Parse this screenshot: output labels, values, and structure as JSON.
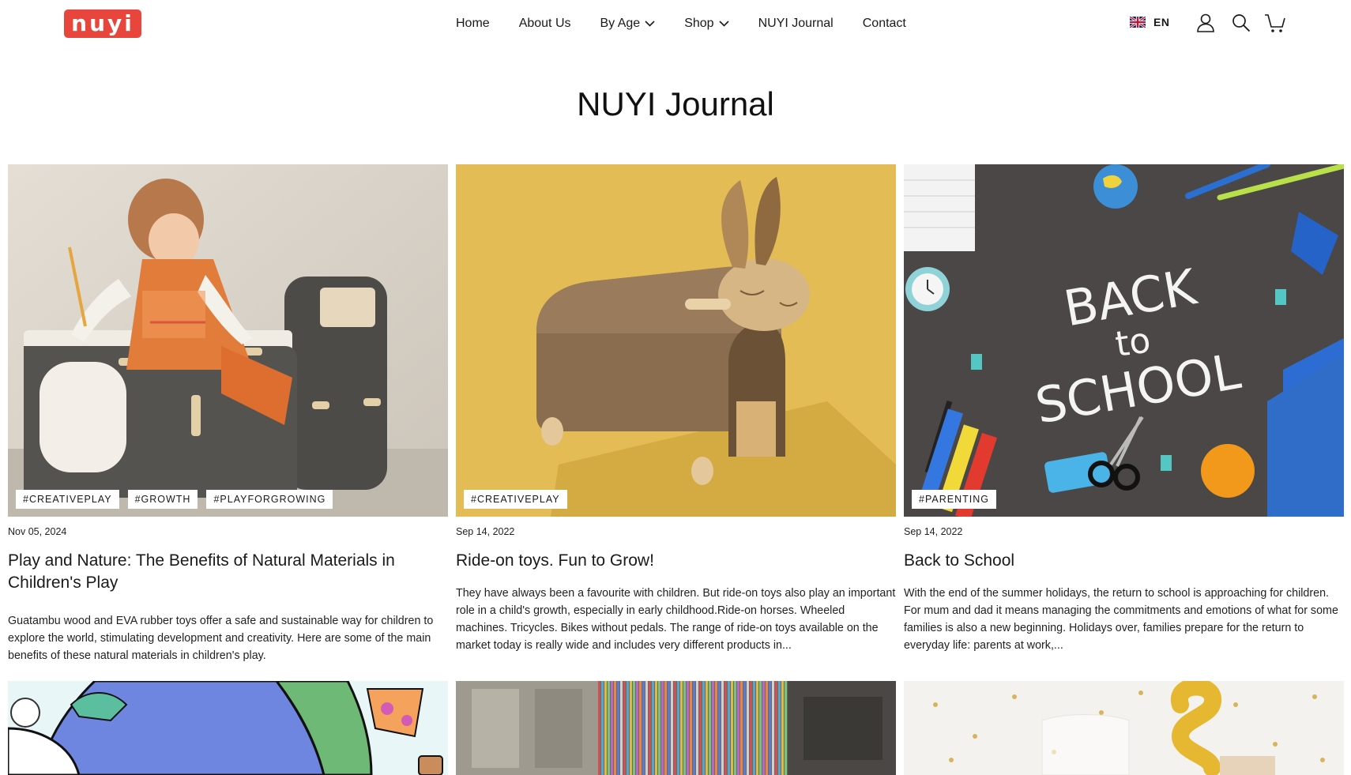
{
  "header": {
    "logo_text": "nuyi",
    "nav": [
      {
        "label": "Home",
        "dropdown": false
      },
      {
        "label": "About Us",
        "dropdown": false
      },
      {
        "label": "By Age",
        "dropdown": true
      },
      {
        "label": "Shop",
        "dropdown": true
      },
      {
        "label": "NUYI Journal",
        "dropdown": false
      },
      {
        "label": "Contact",
        "dropdown": false
      }
    ],
    "language": "EN",
    "icons": [
      "account-icon",
      "search-icon",
      "cart-icon"
    ]
  },
  "page_title": "NUYI Journal",
  "articles": [
    {
      "tags": [
        "#CREATIVEPLAY",
        "#GROWTH",
        "#PLAYFORGROWING"
      ],
      "date": "Nov 05, 2024",
      "title": "Play and Nature: The Benefits of Natural Materials in Children's Play",
      "excerpt": "Guatambu wood and EVA rubber toys offer a safe and sustainable way for children to explore the world, stimulating development and creativity. Here are some of the main benefits of these natural materials in children's play."
    },
    {
      "tags": [
        "#CREATIVEPLAY"
      ],
      "date": "Sep 14, 2022",
      "title": "Ride-on toys. Fun to Grow!",
      "excerpt": "They have always been a favourite with children. But ride-on toys also play an important role in a child's growth, especially in early childhood.Ride-on horses. Wheeled machines. Tricycles. Bikes without pedals. The range of ride-on toys available on the market today is really wide and includes very different products in..."
    },
    {
      "tags": [
        "#PARENTING"
      ],
      "date": "Sep 14, 2022",
      "title": "Back to School",
      "excerpt": "With the end of the summer holidays, the return to school is approaching for children. For mum and dad it means managing the commitments and emotions of what for some families is also a new beginning.   Holidays over, families prepare for the return to everyday life: parents at work,...",
      "image_text": [
        "BACK",
        "to",
        "SCHOOL"
      ]
    }
  ],
  "colors": {
    "brand": "#e8463c",
    "text": "#1a1a1a",
    "mustard": "#e3bc55",
    "chalkboard": "#4a4746"
  }
}
